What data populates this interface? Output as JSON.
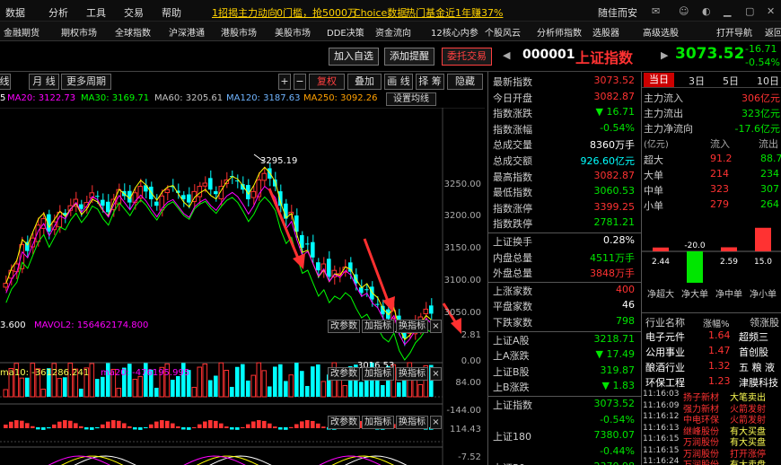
{
  "menu": {
    "items": [
      "数据",
      "分析",
      "工具",
      "交易",
      "帮助"
    ],
    "promo1": "1招揭主力动向",
    "promo2": "0门槛，抢5000万",
    "promo3": "Choice数据",
    "promo4": "热门基金近1年赚37%",
    "account": "随佳而安"
  },
  "nav": [
    "金融期货",
    "期权市场",
    "全球指数",
    "沪深港通",
    "港股市场",
    "美股市场",
    "DDE决策",
    "资金流向",
    "12核心内参",
    "个股风云",
    "分析师指数",
    "选股器",
    "高级选股",
    "打开导航",
    "返回"
  ],
  "toolbar": {
    "btn_add": "加入自选",
    "btn_alert": "添加提醒",
    "btn_trade": "委托交易",
    "code": "000001",
    "name": "上证指数",
    "price": "3073.52",
    "change": "-16.71",
    "pct": "-0.54%"
  },
  "chart_tabs": {
    "t1": "线",
    "t2": "月 线",
    "t3": "更多周期",
    "plus": "+",
    "minus": "−",
    "fq": "复权",
    "overlay": "叠加",
    "draw": "画 线",
    "jq": "择 筹",
    "hide": "隐藏",
    "settings": "设置均线"
  },
  "ma": {
    "ma5": "5",
    "ma20": "MA20: 3122.73",
    "ma30": "MA30: 3169.71",
    "ma60": "MA60: 3205.61",
    "ma120": "MA120: 3187.63",
    "ma250": "MA250: 3092.26"
  },
  "chart_labels": {
    "high": "3295.19",
    "low": "3016.53"
  },
  "yaxis": [
    "3250.00",
    "3200.00",
    "3150.00",
    "3100.00",
    "3050.00"
  ],
  "vol": {
    "label1": "3.600",
    "label2": "MAVOL2: 156462174.800",
    "y1": "2.81",
    "y2": "0.00",
    "btn_param": "改参数",
    "btn_add": "加指标",
    "btn_switch": "换指标",
    "close": "×"
  },
  "ind2": {
    "label1": "ma10: -361286.241",
    "label2": "ma20: -476195.995",
    "y1": "84.00",
    "y2": "-144.00"
  },
  "ind3": {
    "y1": "114.43",
    "y2": "-7.52"
  },
  "stats": [
    {
      "l": "最新指数",
      "v": "3073.52",
      "c": "red"
    },
    {
      "l": "今日开盘",
      "v": "3082.87",
      "c": "red"
    },
    {
      "l": "指数涨跌",
      "v": "▼ 16.71",
      "c": "green"
    },
    {
      "l": "指数涨幅",
      "v": "-0.54%",
      "c": "green"
    },
    {
      "l": "总成交量",
      "v": "8360万手",
      "c": "wh"
    },
    {
      "l": "总成交额",
      "v": "926.60亿元",
      "c": "cy"
    },
    {
      "l": "最高指数",
      "v": "3082.87",
      "c": "red"
    },
    {
      "l": "最低指数",
      "v": "3060.53",
      "c": "green"
    },
    {
      "l": "指数涨停",
      "v": "3399.25",
      "c": "red"
    },
    {
      "l": "指数跌停",
      "v": "2781.21",
      "c": "green"
    }
  ],
  "stats2": [
    {
      "l": "上证换手",
      "v": "0.28%",
      "c": "wh"
    },
    {
      "l": "内盘总量",
      "v": "4511万手",
      "c": "green"
    },
    {
      "l": "外盘总量",
      "v": "3848万手",
      "c": "red"
    }
  ],
  "stats3": [
    {
      "l": "上涨家数",
      "v": "400",
      "c": "red"
    },
    {
      "l": "平盘家数",
      "v": "46",
      "c": "wh"
    },
    {
      "l": "下跌家数",
      "v": "798",
      "c": "green"
    }
  ],
  "stats4": [
    {
      "l": "上证A股",
      "v": "3218.71",
      "c": "green"
    },
    {
      "l": "上A涨跌",
      "v": "▼ 17.49",
      "c": "green"
    },
    {
      "l": "上证B股",
      "v": "319.87",
      "c": "green"
    },
    {
      "l": "上B涨跌",
      "v": "▼ 1.83",
      "c": "green"
    }
  ],
  "stats5": [
    {
      "l": "上证指数",
      "v": "3073.52",
      "c": "green"
    },
    {
      "l": "",
      "v": "-0.54%",
      "c": "green"
    },
    {
      "l": "上证180",
      "v": "7380.07",
      "c": "green"
    },
    {
      "l": "",
      "v": "-0.44%",
      "c": "green"
    },
    {
      "l": "上证50",
      "v": "2370.98",
      "c": "green"
    }
  ],
  "fr_tabs": [
    "当日",
    "3日",
    "5日",
    "10日"
  ],
  "flows": [
    {
      "l": "主力流入",
      "v": "306亿元",
      "c": "red"
    },
    {
      "l": "主力流出",
      "v": "323亿元",
      "c": "green"
    },
    {
      "l": "主力净流向",
      "v": "-17.6亿元",
      "c": "green"
    }
  ],
  "flow_table": {
    "unit": "(亿元)",
    "h1": "流入",
    "h2": "流出",
    "rows": [
      {
        "l": "超大",
        "a": "91.2",
        "b": "88.7"
      },
      {
        "l": "大单",
        "a": "214",
        "b": "234"
      },
      {
        "l": "中单",
        "a": "323",
        "b": "307"
      },
      {
        "l": "小单",
        "a": "279",
        "b": "264"
      }
    ]
  },
  "netbars": {
    "vals": [
      "2.44",
      "-20.0",
      "2.59",
      "15.0"
    ],
    "labels": [
      "净超大",
      "净大单",
      "净中单",
      "净小单"
    ]
  },
  "sectors": {
    "h1": "行业名称",
    "h2": "涨幅%",
    "h3": "领涨股",
    "rows": [
      {
        "n": "电子元件",
        "p": "1.64",
        "s": "超频三"
      },
      {
        "n": "公用事业",
        "p": "1.47",
        "s": "首创股"
      },
      {
        "n": "酿酒行业",
        "p": "1.32",
        "s": "五 粮 液"
      },
      {
        "n": "环保工程",
        "p": "1.23",
        "s": "津膜科技"
      }
    ]
  },
  "ticks": [
    {
      "t": "11:16:03",
      "n": "扬子新材",
      "e": "大笔卖出",
      "ec": "yel"
    },
    {
      "t": "11:16:09",
      "n": "强力新材",
      "e": "火箭发射",
      "ec": "red"
    },
    {
      "t": "11:16:12",
      "n": "中电环保",
      "e": "火箭发射",
      "ec": "red"
    },
    {
      "t": "11:16:13",
      "n": "继峰股份",
      "e": "有大买盘",
      "ec": "yel"
    },
    {
      "t": "11:16:15",
      "n": "万润股份",
      "e": "有大买盘",
      "ec": "yel"
    },
    {
      "t": "11:16:15",
      "n": "万润股份",
      "e": "打开涨停",
      "ec": "red"
    },
    {
      "t": "11:16:24",
      "n": "万润股份",
      "e": "有大卖盘",
      "ec": "yel"
    }
  ],
  "colors": {
    "up": "#ff3232",
    "down": "#00ffff",
    "ma5": "#ffffff",
    "ma10": "#ffff00",
    "ma20": "#ff00ff",
    "ma30": "#00ff00",
    "ma60": "#c0c0c0",
    "ma120": "#6fb4ff",
    "ma250": "#ffa000"
  }
}
